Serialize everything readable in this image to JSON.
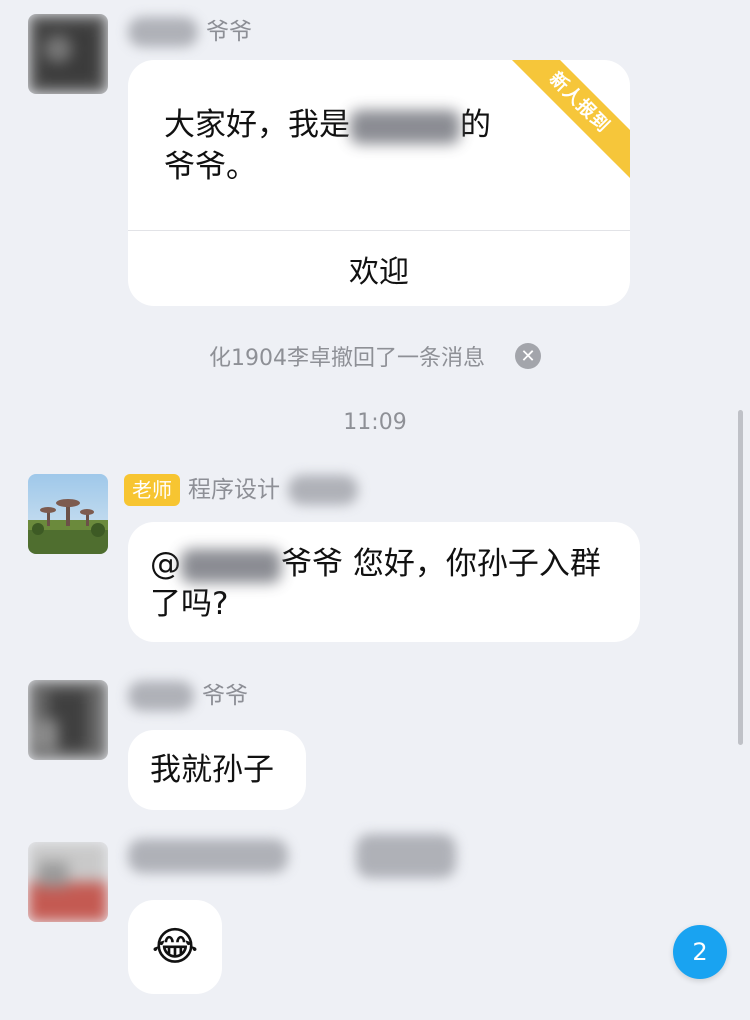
{
  "messages": {
    "first": {
      "sender_suffix": "爷爷"
    },
    "welcome_card": {
      "ribbon": "新人报到",
      "text_start": "大家好，我是",
      "text_mid": "的",
      "text_end": "爷爷。",
      "button": "欢迎"
    },
    "recall_notice": "化1904李卓撤回了一条消息",
    "time": "11:09",
    "teacher": {
      "badge": "老师",
      "sender_name": "程序设计",
      "text_at": "@",
      "text_rest": "爷爷   您好，你孙子入群了吗?"
    },
    "grandpa": {
      "sender_suffix": "爷爷",
      "text": "我就孙子"
    },
    "last": {
      "emoji": "😂"
    }
  },
  "unread_count": "2",
  "colors": {
    "accent": "#19a3f1",
    "badge": "#f7c531",
    "background": "#eef0f5"
  }
}
